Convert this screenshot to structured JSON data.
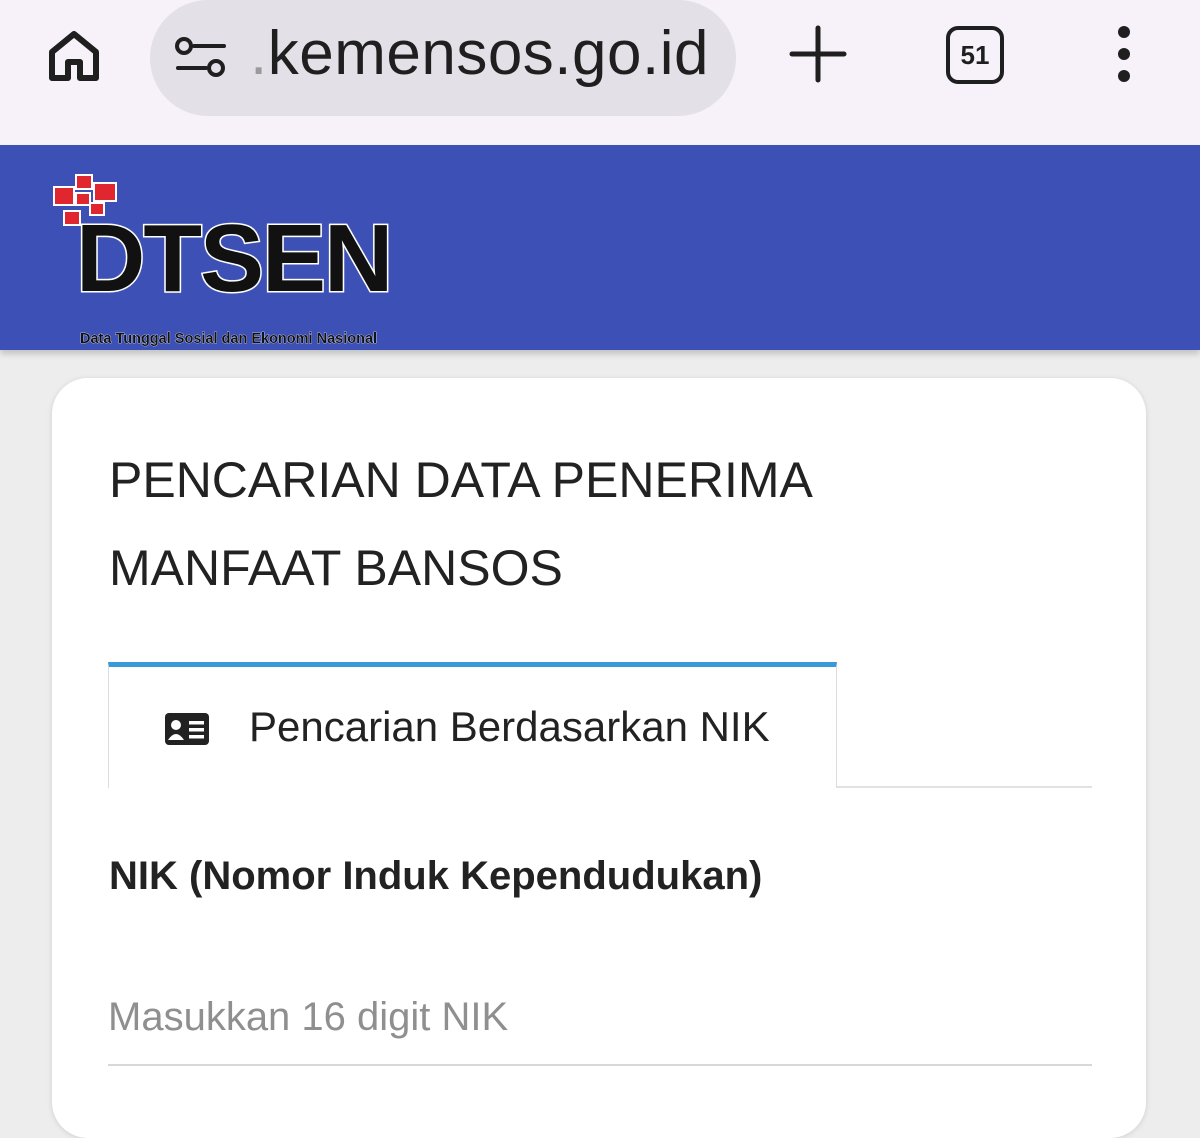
{
  "browser": {
    "url_prefix": ".",
    "url_domain": "kemensos.go.id",
    "tab_count": "51",
    "icons": [
      "home-icon",
      "site-settings-icon",
      "new-tab-icon",
      "tab-switcher-icon",
      "more-menu-icon"
    ]
  },
  "header": {
    "logo_title": "DTSEN",
    "logo_subtitle": "Data Tunggal Sosial dan Ekonomi Nasional",
    "background_color": "#3d50b6",
    "logo_accent_color": "#e0262f"
  },
  "main": {
    "title_line1": "PENCARIAN DATA PENERIMA",
    "title_line2": "MANFAAT BANSOS",
    "tabs": [
      {
        "label": "Pencarian Berdasarkan NIK",
        "icon": "id-card-icon",
        "active": true
      }
    ],
    "tab_accent_color": "#3a9ad9",
    "nik_field": {
      "label": "NIK (Nomor Induk Kependudukan)",
      "placeholder": "Masukkan 16 digit NIK",
      "value": ""
    }
  }
}
